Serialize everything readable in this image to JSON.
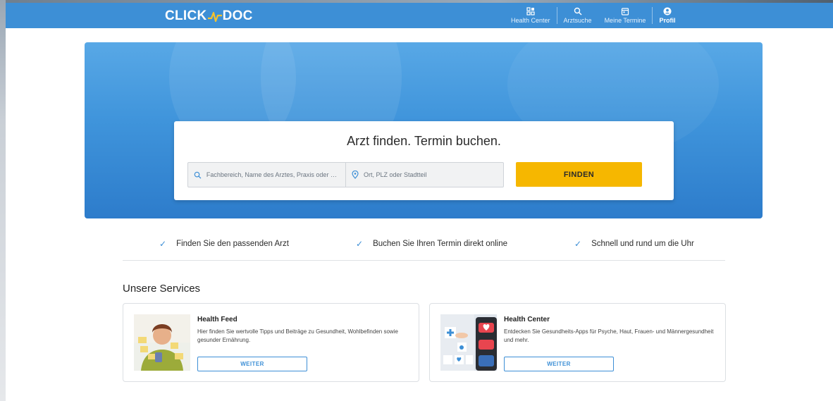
{
  "header": {
    "logo_left": "CLICK",
    "logo_right": "DOC",
    "nav": [
      {
        "label": "Health Center",
        "icon": "grid-icon"
      },
      {
        "label": "Arztsuche",
        "icon": "search-icon"
      },
      {
        "label": "Meine Termine",
        "icon": "calendar-icon"
      },
      {
        "label": "Profil",
        "icon": "user-icon"
      }
    ],
    "active_nav": "Profil"
  },
  "search": {
    "title": "Arzt finden. Termin buchen.",
    "specialty_placeholder": "Fachbereich, Name des Arztes, Praxis oder Ei...",
    "location_placeholder": "Ort, PLZ oder Stadtteil",
    "button_label": "FINDEN"
  },
  "benefits": [
    "Finden Sie den passenden Arzt",
    "Buchen Sie Ihren Termin direkt online",
    "Schnell und rund um die Uhr"
  ],
  "services": {
    "heading": "Unsere Services",
    "items": [
      {
        "title": "Health Feed",
        "description": "Hier finden Sie wertvolle Tipps und Beiträge zu Gesundheit, Wohlbefinden sowie gesunder Ernährung.",
        "button": "WEITER"
      },
      {
        "title": "Health Center",
        "description": "Entdecken Sie Gesundheits-Apps für Psyche, Haut, Frauen- und Männergesundheit und mehr.",
        "button": "WEITER"
      }
    ]
  },
  "colors": {
    "brand_blue": "#3d8fd6",
    "accent_yellow": "#f6b700",
    "logo_pulse": "#f6c22b"
  }
}
